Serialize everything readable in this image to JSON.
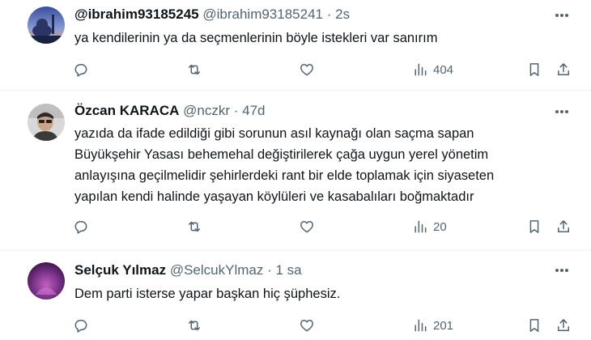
{
  "tweets": [
    {
      "display_name": "@ibrahim93185245",
      "handle": "@ibrahim93185241",
      "time": "· 2s",
      "text_lines": [
        "ya kendilerinin ya da seçmenlerinin böyle istekleri var sanırım"
      ],
      "views": "404",
      "avatar_colors": [
        "#6a7fc8",
        "#e8a060"
      ]
    },
    {
      "display_name": "Özcan KARACA",
      "handle": "@nczkr",
      "time": "· 47d",
      "text_lines": [
        "yazıda da ifade edildiği gibi sorunun asıl kaynağı olan saçma sapan",
        "Büyükşehir Yasası behemehal değiştirilerek çağa uygun yerel yönetim",
        "anlayışına geçilmelidir şehirlerdeki rant bir elde toplamak için siyaseten",
        "yapılan kendi halinde yaşayan köylüleri ve kasabalıları boğmaktadır"
      ],
      "views": "20",
      "avatar_colors": [
        "#c9c9c9",
        "#4a4a4a"
      ]
    },
    {
      "display_name": "Selçuk Yılmaz",
      "handle": "@SelcukYlmaz",
      "time": "· 1 sa",
      "text_lines": [
        "Dem parti isterse yapar başkan hiç şüphesiz."
      ],
      "views": "201",
      "avatar_colors": [
        "#5a2a6a",
        "#c060c0"
      ]
    }
  ],
  "icons": [
    "more-icon",
    "reply-icon",
    "retweet-icon",
    "like-icon",
    "views-icon",
    "bookmark-icon",
    "share-icon"
  ],
  "colors": {
    "text": "#0f1419",
    "secondary": "#536471",
    "divider": "#eff3f4",
    "background": "#ffffff"
  }
}
